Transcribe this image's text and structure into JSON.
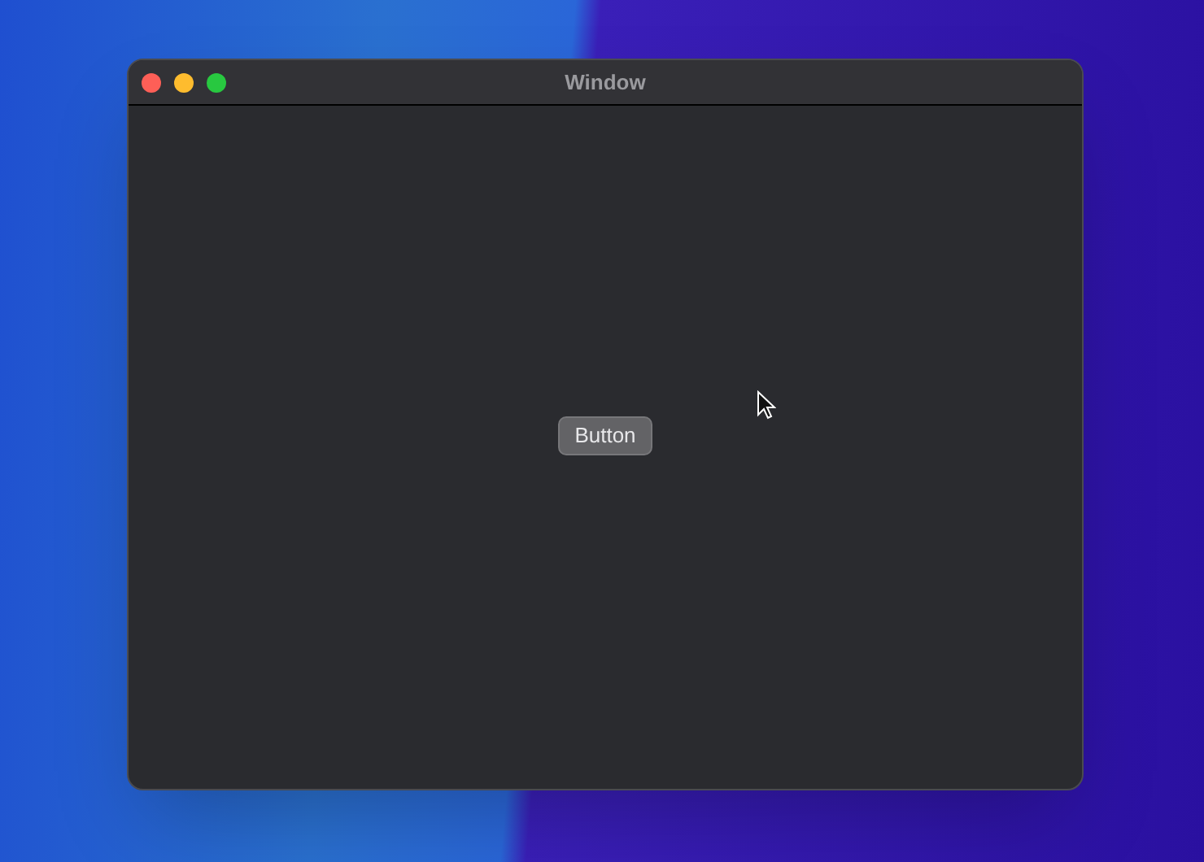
{
  "window": {
    "title": "Window"
  },
  "content": {
    "button": {
      "label": "Button"
    }
  }
}
